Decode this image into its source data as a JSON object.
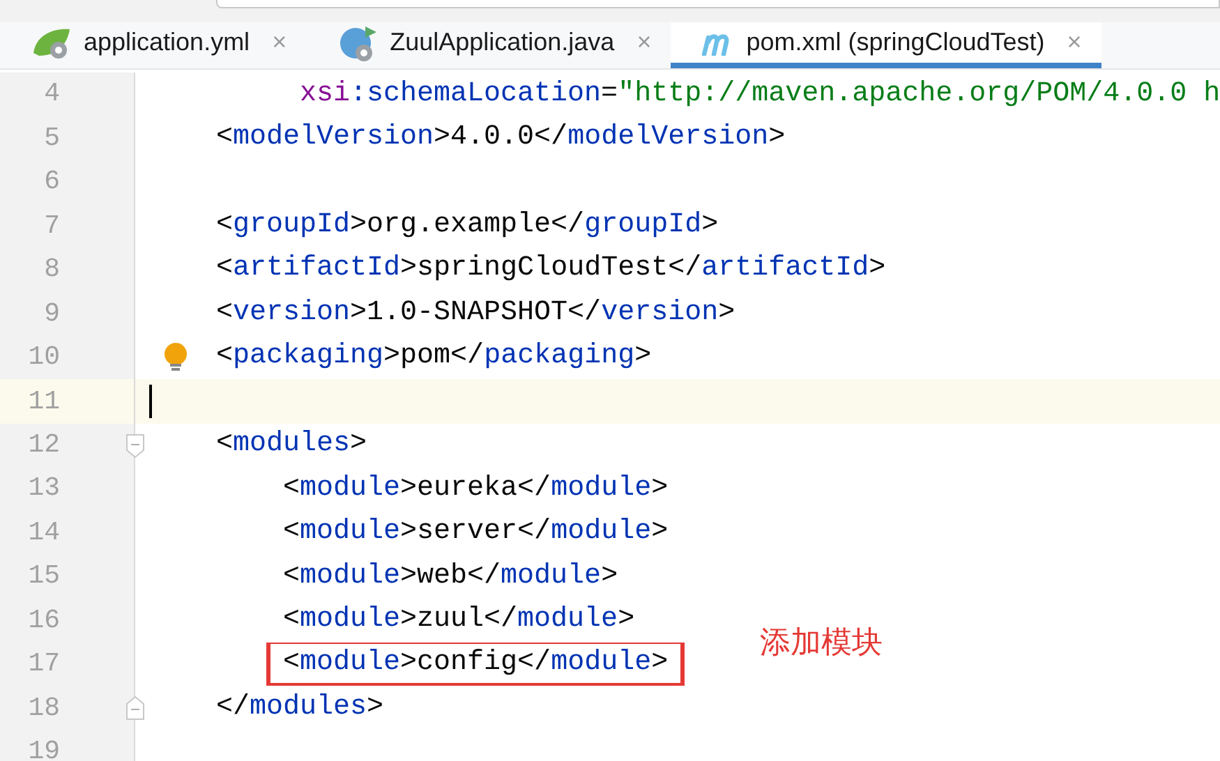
{
  "tabs": [
    {
      "label": "application.yml",
      "kind": "spring",
      "close": "×",
      "selected": false
    },
    {
      "label": "ZuulApplication.java",
      "kind": "java",
      "close": "×",
      "selected": false
    },
    {
      "label": "pom.xml (springCloudTest)",
      "kind": "maven",
      "close": "×",
      "selected": true
    }
  ],
  "lines": [
    {
      "number": "4",
      "kind": "continuation",
      "current": false,
      "boxed": false,
      "tokens": [
        {
          "kind": "a",
          "text": "xsi"
        },
        {
          "kind": "t",
          "text": ":schemaLocation"
        },
        {
          "kind": "p",
          "text": "="
        },
        {
          "kind": "s",
          "text": "\"http://maven.apache.org/POM/4.0.0 h"
        }
      ]
    },
    {
      "number": "5",
      "kind": "element",
      "current": false,
      "boxed": false,
      "tokens": [
        {
          "kind": "p",
          "text": "<"
        },
        {
          "kind": "t",
          "text": "modelVersion"
        },
        {
          "kind": "p",
          "text": ">4.0.0</"
        },
        {
          "kind": "t",
          "text": "modelVersion"
        },
        {
          "kind": "p",
          "text": ">"
        }
      ]
    },
    {
      "number": "6",
      "current": false,
      "boxed": false
    },
    {
      "number": "7",
      "kind": "element",
      "current": false,
      "boxed": false,
      "tokens": [
        {
          "kind": "p",
          "text": "<"
        },
        {
          "kind": "t",
          "text": "groupId"
        },
        {
          "kind": "p",
          "text": ">org.example</"
        },
        {
          "kind": "t",
          "text": "groupId"
        },
        {
          "kind": "p",
          "text": ">"
        }
      ]
    },
    {
      "number": "8",
      "kind": "element",
      "current": false,
      "boxed": false,
      "tokens": [
        {
          "kind": "p",
          "text": "<"
        },
        {
          "kind": "t",
          "text": "artifactId"
        },
        {
          "kind": "p",
          "text": ">springCloudTest</"
        },
        {
          "kind": "t",
          "text": "artifactId"
        },
        {
          "kind": "p",
          "text": ">"
        }
      ]
    },
    {
      "number": "9",
      "kind": "element",
      "current": false,
      "boxed": false,
      "tokens": [
        {
          "kind": "p",
          "text": "<"
        },
        {
          "kind": "t",
          "text": "version"
        },
        {
          "kind": "p",
          "text": ">1.0-SNAPSHOT</"
        },
        {
          "kind": "t",
          "text": "version"
        },
        {
          "kind": "p",
          "text": ">"
        }
      ]
    },
    {
      "number": "10",
      "kind": "element",
      "current": false,
      "boxed": false,
      "hint": true,
      "tokens": [
        {
          "kind": "p",
          "text": "<"
        },
        {
          "kind": "t",
          "text": "packaging"
        },
        {
          "kind": "p",
          "text": ">pom</"
        },
        {
          "kind": "t",
          "text": "packaging"
        },
        {
          "kind": "p",
          "text": ">"
        }
      ]
    },
    {
      "number": "11",
      "current": true,
      "boxed": false
    },
    {
      "number": "12",
      "kind": "element",
      "current": false,
      "boxed": false,
      "fold_open": true,
      "tokens": [
        {
          "kind": "p",
          "text": "<"
        },
        {
          "kind": "t",
          "text": "modules"
        },
        {
          "kind": "p",
          "text": ">"
        }
      ]
    },
    {
      "number": "13",
      "kind": "child",
      "current": false,
      "boxed": false,
      "tokens": [
        {
          "kind": "p",
          "text": "<"
        },
        {
          "kind": "t",
          "text": "module"
        },
        {
          "kind": "p",
          "text": ">eureka</"
        },
        {
          "kind": "t",
          "text": "module"
        },
        {
          "kind": "p",
          "text": ">"
        }
      ]
    },
    {
      "number": "14",
      "kind": "child",
      "current": false,
      "boxed": false,
      "tokens": [
        {
          "kind": "p",
          "text": "<"
        },
        {
          "kind": "t",
          "text": "module"
        },
        {
          "kind": "p",
          "text": ">server</"
        },
        {
          "kind": "t",
          "text": "module"
        },
        {
          "kind": "p",
          "text": ">"
        }
      ]
    },
    {
      "number": "15",
      "kind": "child",
      "current": false,
      "boxed": false,
      "tokens": [
        {
          "kind": "p",
          "text": "<"
        },
        {
          "kind": "t",
          "text": "module"
        },
        {
          "kind": "p",
          "text": ">web</"
        },
        {
          "kind": "t",
          "text": "module"
        },
        {
          "kind": "p",
          "text": ">"
        }
      ]
    },
    {
      "number": "16",
      "kind": "child",
      "current": false,
      "boxed": false,
      "tokens": [
        {
          "kind": "p",
          "text": "<"
        },
        {
          "kind": "t",
          "text": "module"
        },
        {
          "kind": "p",
          "text": ">zuul</"
        },
        {
          "kind": "t",
          "text": "module"
        },
        {
          "kind": "p",
          "text": ">"
        }
      ]
    },
    {
      "number": "17",
      "kind": "child",
      "current": false,
      "boxed": true,
      "tokens": [
        {
          "kind": "p",
          "text": "<"
        },
        {
          "kind": "t",
          "text": "module"
        },
        {
          "kind": "p",
          "text": ">config</"
        },
        {
          "kind": "t",
          "text": "module"
        },
        {
          "kind": "p",
          "text": ">"
        }
      ]
    },
    {
      "number": "18",
      "kind": "element",
      "current": false,
      "boxed": false,
      "fold_close": true,
      "tokens": [
        {
          "kind": "p",
          "text": "</"
        },
        {
          "kind": "t",
          "text": "modules"
        },
        {
          "kind": "p",
          "text": ">"
        }
      ]
    },
    {
      "number": "19",
      "current": false,
      "boxed": false
    }
  ],
  "annotation": {
    "text": "添加模块"
  }
}
